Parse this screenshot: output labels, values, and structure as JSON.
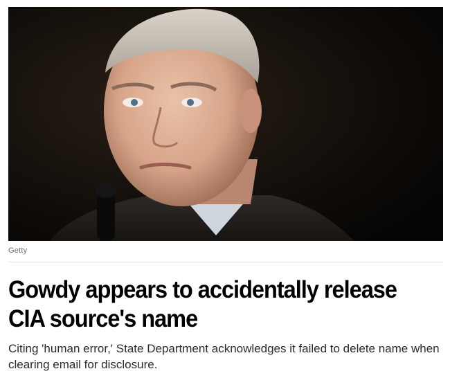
{
  "article": {
    "image_alt": "Photo of Trey Gowdy",
    "image_credit": "Getty",
    "headline": "Gowdy appears to accidentally release CIA source's name",
    "dek": "Citing 'human error,' State Department acknowledges it failed to delete name when clearing email for disclosure."
  }
}
